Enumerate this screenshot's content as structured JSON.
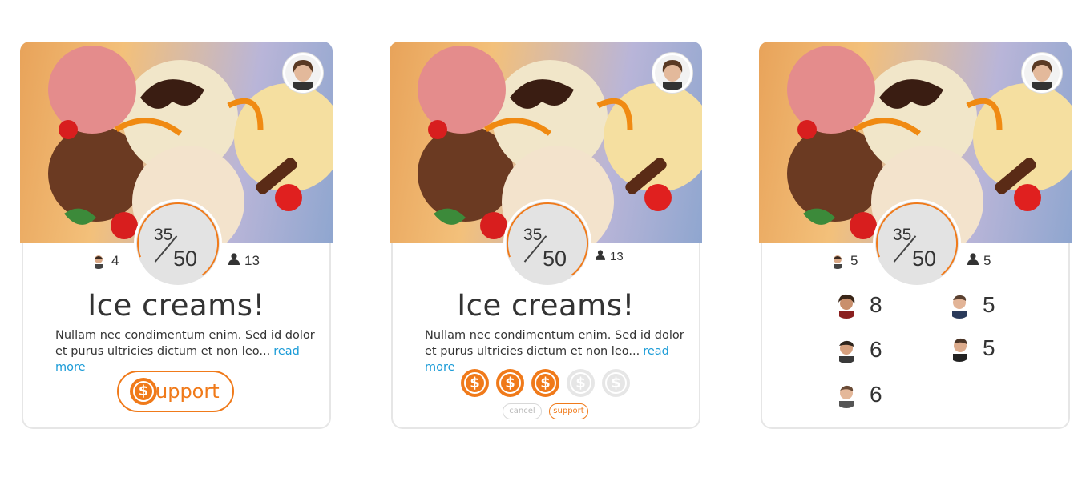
{
  "cards": [
    {
      "progress": {
        "current": "35",
        "goal": "50",
        "fraction": 0.7
      },
      "backers_count": "4",
      "followers_count": "13",
      "title": "Ice creams!",
      "description": "Nullam nec condimentum enim. Sed id dolor et purus ultricies dictum et non leo...",
      "read_more": "read more",
      "support_label": "upport",
      "coin_symbol": "$"
    },
    {
      "progress": {
        "current": "35",
        "goal": "50",
        "fraction": 0.7
      },
      "followers_count": "13",
      "title": "Ice creams!",
      "description": "Nullam nec condimentum enim. Sed id dolor et purus ultricies dictum et non leo...",
      "read_more": "read more",
      "coin_symbol": "$",
      "coins_selected": 3,
      "coins_total": 5,
      "cancel_label": "cancel",
      "support_label": "support"
    },
    {
      "progress": {
        "current": "35",
        "goal": "50",
        "fraction": 0.7
      },
      "backers_count": "5",
      "followers_count": "5",
      "supporters": [
        {
          "amount": "8"
        },
        {
          "amount": "5"
        },
        {
          "amount": "6"
        },
        {
          "amount": "5"
        },
        {
          "amount": "6"
        }
      ]
    }
  ],
  "colors": {
    "accent": "#f07a1a",
    "link": "#1a9bd7",
    "ring_track": "#e3e3e3"
  },
  "icons": {
    "user": "user-icon",
    "coin": "dollar-coin-icon"
  }
}
